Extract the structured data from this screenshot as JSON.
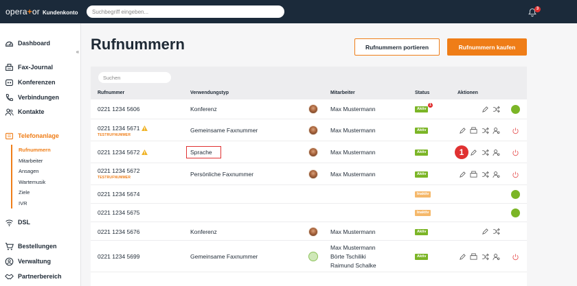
{
  "app": {
    "brand_left": "opera",
    "brand_mid": "+",
    "brand_right": "or",
    "section": "Kundenkonto",
    "search_placeholder": "Suchbegriff eingeben...",
    "notification_count": "3"
  },
  "sidebar": {
    "collapse_glyph": "«",
    "items": [
      {
        "label": "Dashboard",
        "icon": "dashboard-icon"
      },
      {
        "label": "Fax-Journal",
        "icon": "fax-icon"
      },
      {
        "label": "Konferenzen",
        "icon": "conference-icon"
      },
      {
        "label": "Verbindungen",
        "icon": "phone-icon"
      },
      {
        "label": "Kontakte",
        "icon": "contacts-icon"
      },
      {
        "label": "Telefonanlage",
        "icon": "pbx-icon"
      },
      {
        "label": "DSL",
        "icon": "wifi-icon"
      },
      {
        "label": "Bestellungen",
        "icon": "cart-icon"
      },
      {
        "label": "Verwaltung",
        "icon": "user-circle-icon"
      },
      {
        "label": "Partnerbereich",
        "icon": "handshake-icon"
      }
    ],
    "subitems": [
      "Rufnummern",
      "Mitarbeiter",
      "Ansagen",
      "Wartemusik",
      "Ziele",
      "IVR"
    ]
  },
  "page": {
    "title": "Rufnummern",
    "btn_port": "Rufnummern portieren",
    "btn_buy": "Rufnummern kaufen"
  },
  "table": {
    "search_placeholder": "Suchen",
    "headers": {
      "number": "Rufnummer",
      "usage": "Verwendungstyp",
      "employee": "Mitarbeiter",
      "status": "Status",
      "actions": "Aktionen"
    },
    "test_tag": "TESTRUFNUMMER",
    "rows": [
      {
        "number": "0221 1234 5606",
        "usage": "Konferenz",
        "employee": "Max Mustermann",
        "status": "Aktiv",
        "status_badge": "1"
      },
      {
        "number": "0221 1234 5671",
        "usage": "Gemeinsame Faxnummer",
        "employee": "Max Mustermann",
        "status": "Aktiv"
      },
      {
        "number": "0221 1234 5672",
        "usage": "Sprache",
        "employee": "Max Mustermann",
        "status": "Aktiv"
      },
      {
        "number": "0221 1234 5672",
        "usage": "Persönliche Faxnummer",
        "employee": "Max Mustermann",
        "status": "Aktiv"
      },
      {
        "number": "0221 1234 5674",
        "usage": "",
        "employee": "",
        "status": "Inaktiv"
      },
      {
        "number": "0221 1234 5675",
        "usage": "",
        "employee": "",
        "status": "Inaktiv"
      },
      {
        "number": "0221 1234 5676",
        "usage": "Konferenz",
        "employee": "Max Mustermann",
        "status": "Aktiv"
      },
      {
        "number": "0221 1234 5699",
        "usage": "Gemeinsame Faxnummer",
        "employee_1": "Max Mustermann",
        "employee_2": "Börte Tschiliki",
        "employee_3": "Raimund Schalke",
        "status": "Aktiv"
      }
    ]
  },
  "annotation": {
    "marker": "1"
  },
  "colors": {
    "accent": "#ef7d17",
    "active_green": "#7bb526",
    "inactive_orange": "#f5b86a",
    "danger": "#e03131",
    "topbar": "#1b2a3a"
  }
}
